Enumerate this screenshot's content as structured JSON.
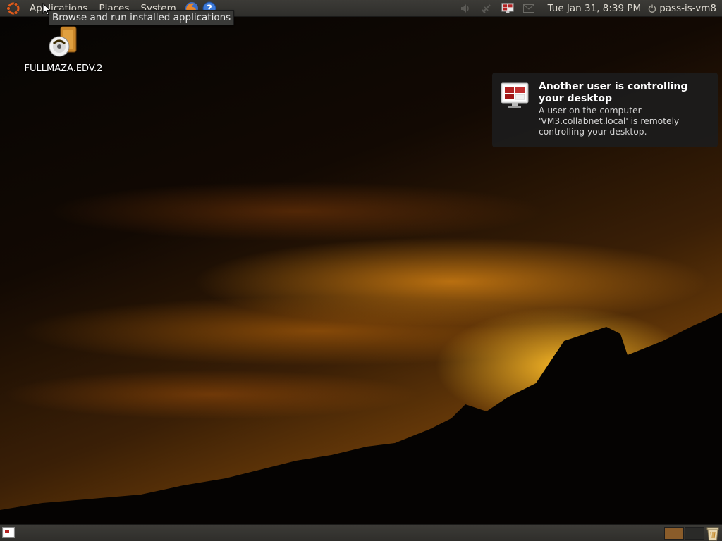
{
  "top_panel": {
    "menus": [
      "Applications",
      "Places",
      "System"
    ],
    "clock": "Tue Jan 31,  8:39 PM",
    "user": "pass-is-vm8",
    "icons": [
      "ubuntu-logo-icon",
      "firefox-icon",
      "help-icon",
      "volume-icon",
      "network-icon",
      "remote-desktop-icon",
      "mail-icon",
      "power-icon"
    ]
  },
  "tooltip": {
    "text": "Browse and run installed applications"
  },
  "desktop": {
    "icons": [
      {
        "label": "FULLMAZA.EDV.2",
        "icon": "media-archive-icon"
      }
    ]
  },
  "notification": {
    "title": "Another user is controlling your desktop",
    "body": "A user on the computer 'VM3.collabnet.local' is remotely controlling your desktop.",
    "icon": "remote-desktop-icon"
  },
  "bottom_panel": {
    "icons": [
      "show-desktop-icon",
      "workspace-switcher",
      "trash-icon"
    ]
  },
  "colors": {
    "panel": "#3c3b37",
    "notification_bg": "#1c1c1c",
    "workspace_active": "#8a5c2a"
  }
}
